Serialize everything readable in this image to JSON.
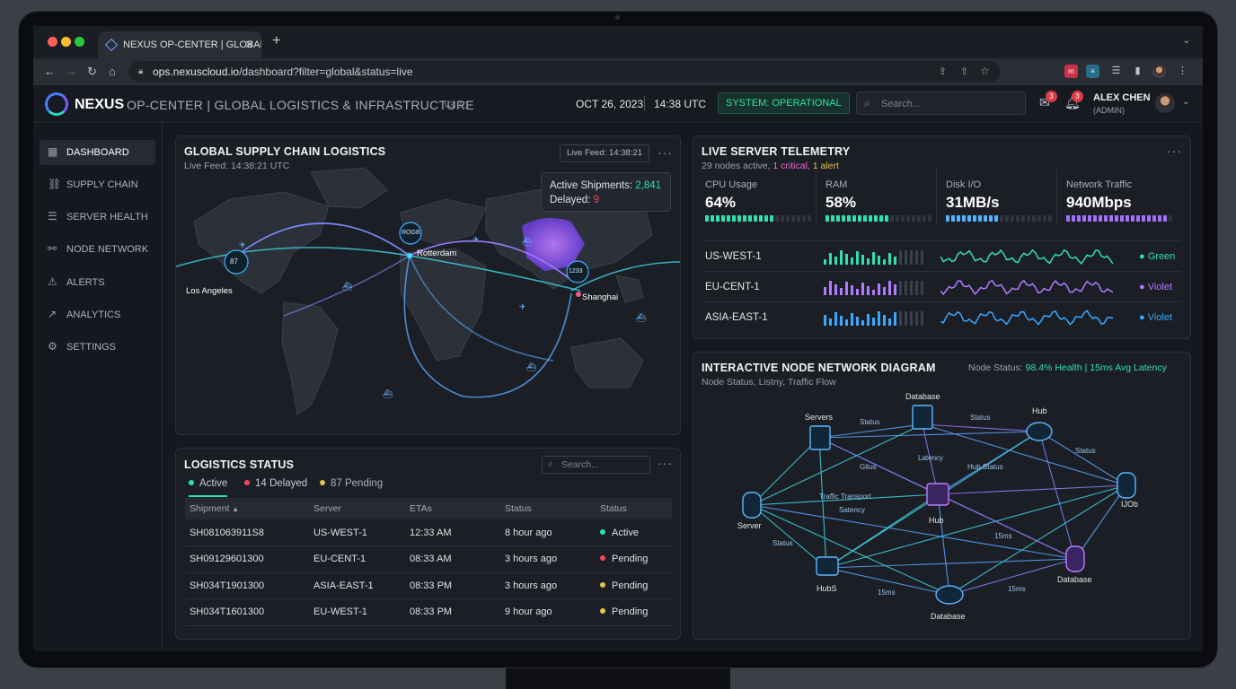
{
  "browser": {
    "tab_title": "NEXUS OP-CENTER | GLOBAL LOGISTICS",
    "url_host": "ops.nexuscloud.io",
    "url_path": "/dashboard?filter=global&status=live"
  },
  "header": {
    "brand": "NEXUS",
    "subtitle": "OP-CENTER | GLOBAL LOGISTICS & INFRASTRUCTURE",
    "version": "v3.2.1",
    "date": "OCT 26, 2023",
    "time": "14:38 UTC",
    "status": "SYSTEM: OPERATIONAL",
    "search_placeholder": "Search...",
    "mail_count": "3",
    "notif_count": "3",
    "user_name": "ALEX CHEN",
    "user_role": "(ADMIN)"
  },
  "sidebar": {
    "items": [
      {
        "label": "DASHBOARD",
        "icon": "grid-icon"
      },
      {
        "label": "SUPPLY CHAIN",
        "icon": "link-icon"
      },
      {
        "label": "SERVER HEALTH",
        "icon": "server-icon"
      },
      {
        "label": "NODE NETWORK",
        "icon": "network-icon"
      },
      {
        "label": "ALERTS",
        "icon": "alert-icon"
      },
      {
        "label": "ANALYTICS",
        "icon": "chart-icon"
      },
      {
        "label": "SETTINGS",
        "icon": "gear-icon"
      }
    ]
  },
  "map": {
    "title": "GLOBAL SUPPLY CHAIN LOGISTICS",
    "subtitle": "Live Feed: 14:38:21 UTC",
    "chip": "Live Feed: 14:38:21",
    "tooltip_active_label": "Active Shipments:",
    "tooltip_active_value": "2,841",
    "tooltip_delayed_label": "Delayed:",
    "tooltip_delayed_value": "9",
    "cities": [
      "Los Angeles",
      "Rotterdam",
      "Shanghai"
    ],
    "markers": [
      "87",
      "ROGB",
      "1233"
    ]
  },
  "logistics": {
    "title": "LOGISTICS STATUS",
    "search_placeholder": "Search...",
    "tabs": [
      "Active",
      "14 Delayed",
      "87 Pending"
    ],
    "columns": [
      "Shipment",
      "Server",
      "ETAs",
      "Status",
      "Status"
    ],
    "rows": [
      [
        "SH081063911S8",
        "US-WEST-1",
        "12:33 AM",
        "8 hour ago",
        "Active"
      ],
      [
        "SH09129601300",
        "EU-CENT-1",
        "08:33 AM",
        "3 hours ago",
        "Pending"
      ],
      [
        "SH034T1901300",
        "ASIA-EAST-1",
        "08:33 PM",
        "3 hours ago",
        "Pending"
      ],
      [
        "SH034T1601300",
        "EU-WEST-1",
        "08:33 PM",
        "9 hour ago",
        "Pending"
      ]
    ],
    "status_colors": {
      "Active": "#2ee0b3",
      "Pending": "#f04a55",
      "Pending2": "#e6c34b"
    }
  },
  "telemetry": {
    "title": "LIVE SERVER TELEMETRY",
    "sub_nodes": "29 nodes active,",
    "sub_critical": "1 critical,",
    "sub_alert": "1 alert",
    "metrics": [
      {
        "label": "CPU Usage",
        "value": "64%",
        "level": 0.64,
        "color": "#2ee0b3"
      },
      {
        "label": "RAM",
        "value": "58%",
        "level": 0.58,
        "color": "#2ee0b3"
      },
      {
        "label": "Disk I/O",
        "value": "31MB/s",
        "level": 0.5,
        "color": "#4fb3ff"
      },
      {
        "label": "Network Traffic",
        "value": "940Mbps",
        "level": 0.94,
        "color": "#a070ff"
      }
    ],
    "servers": [
      {
        "name": "US-WEST-1",
        "legend": "Green",
        "color": "#2ee0b3"
      },
      {
        "name": "EU-CENT-1",
        "legend": "Violet",
        "color": "#b07cff"
      },
      {
        "name": "ASIA-EAST-1",
        "legend": "Violet",
        "color": "#3aa8ff"
      }
    ]
  },
  "network": {
    "title": "INTERACTIVE NODE NETWORK DIAGRAM",
    "status_label": "Node Status:",
    "status_value": "98.4% Health | 15ms Avg Latency",
    "subtitle": "Node Status, Listny, Traffic Flow",
    "nodes": [
      "Database",
      "Servers",
      "Hub",
      "Server",
      "Hub",
      "IJOb",
      "HubS",
      "Database",
      "Database"
    ],
    "edge_labels": [
      "Status",
      "Status",
      "Status",
      "Traffic Transport",
      "Satency",
      "Latency",
      "Gltus",
      "Hub Status",
      "15ms",
      "15ms",
      "15ms",
      "Status"
    ]
  }
}
